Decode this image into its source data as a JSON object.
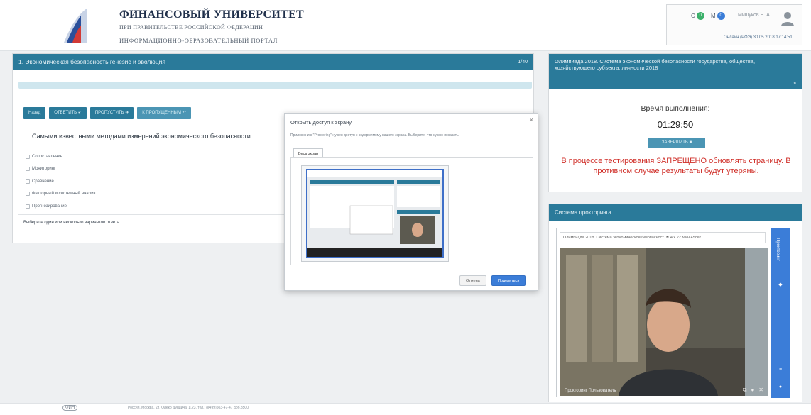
{
  "header": {
    "university_name": "ФИНАНСОВЫЙ УНИВЕРСИТЕТ",
    "subtitle": "ПРИ ПРАВИТЕЛЬСТВЕ РОССИЙСКОЙ ФЕДЕРАЦИИ",
    "portal": "ИНФОРМАЦИОННО-ОБРАЗОВАТЕЛЬНЫЙ ПОРТАЛ",
    "counter_c": "С",
    "counter_c_value": "0",
    "counter_m": "М",
    "counter_m_value": "0",
    "username": "Мишуков Е. А.",
    "links": "Онлайн (РФЭ)   30.05.2018 17:14:51"
  },
  "main": {
    "title": "1. Экономическая безопасность генезис и эволюция",
    "title_right": "1/40",
    "buttons": {
      "back": "Назад",
      "answer": "ОТВЕТИТЬ ✔",
      "skip": "ПРОПУСТИТЬ ➜",
      "skipped": "К ПРОПУЩЕННЫМ ↶"
    },
    "question": "Самыми известными методами измерений экономического безопасности",
    "options": [
      "Сопоставление",
      "Мониторинг",
      "Сравнение",
      "Факторный и системный анализ",
      "Прогнозирование"
    ],
    "hint": "Выберите один или несколько вариантов ответа"
  },
  "dialog": {
    "title": "Открыть доступ к экрану",
    "close": "×",
    "description": "Приложению \"Proctoring\" нужен доступ к содержимому вашего экрана. Выберите, что нужно показать.",
    "tab": "Весь экран",
    "cancel": "Отмена",
    "share": "Поделиться"
  },
  "exam": {
    "title": "Олимпиада 2018. Система экономической безопасности государства, общества, хозяйствующего субъекта, личности 2018",
    "arrow": "»",
    "time_label": "Время выполнения:",
    "timer": "01:29:50",
    "finish_button": "ЗАВЕРШИТЬ ■",
    "warning": "В процессе тестирования ЗАПРЕЩЕНО обновлять страницу. В противном случае результаты будут утеряны."
  },
  "proctoring": {
    "title": "Система прокторинга",
    "window_title": "Олимпиада 2018. Система экономической безопасност. ⚑ 4 х 22 Мин 45сек",
    "video_label": "Прокторинг Пользователь",
    "rail_label": "Прокторинг"
  },
  "footer": {
    "logo": "ФИН",
    "text": "Россия, Москва, ул. Олеко Дундича, д.23, тел.: 8(499)503-47-47 доб.8500"
  },
  "colors": {
    "primary": "#2a7a9a",
    "accent": "#3b7dd8",
    "warning": "#d0302a"
  }
}
